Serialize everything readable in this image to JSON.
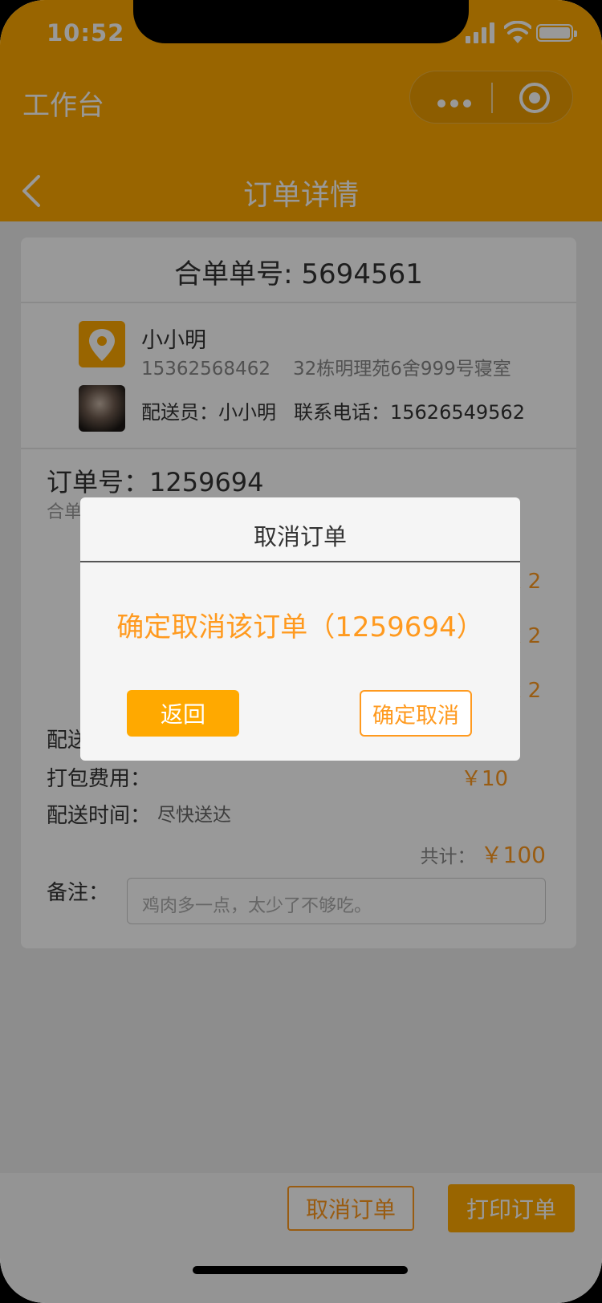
{
  "status_bar": {
    "time": "10:52"
  },
  "mini_program": {
    "title": "工作台"
  },
  "nav": {
    "title": "订单详情"
  },
  "order": {
    "merge_no": "合单单号: 5694561",
    "customer_name": "小小明",
    "customer_phone": "15362568462",
    "customer_address": "32栋明理苑6舍999号寝室",
    "courier_label": "配送员：小小明",
    "courier_phone_label": "联系电话：15626549562",
    "order_no": "订单号：1259694",
    "merge_partial": "合单",
    "item_qtys": [
      "x 2",
      "x 2",
      "x 2"
    ],
    "delivery_label_partial": "配送",
    "pack_fee_label": "打包费用：",
    "pack_fee_value": "￥10",
    "delivery_time_label": "配送时间：",
    "delivery_time_value": "尽快送达",
    "total_label": "共计：",
    "total_value": "￥100",
    "remark_label": "备注：",
    "remark_value": "鸡肉多一点，太少了不够吃。"
  },
  "footer": {
    "cancel_label": "取消订单",
    "print_label": "打印订单"
  },
  "modal": {
    "title": "取消订单",
    "message": "确定取消该订单（1259694）",
    "back_label": "返回",
    "confirm_label": "确定取消"
  },
  "colors": {
    "brand": "#FFA900",
    "accent": "#FF9A1F"
  },
  "icons": [
    "signal-icon",
    "wifi-icon",
    "battery-icon",
    "more-dots-icon",
    "target-icon",
    "back-chevron-icon",
    "location-pin-icon"
  ]
}
